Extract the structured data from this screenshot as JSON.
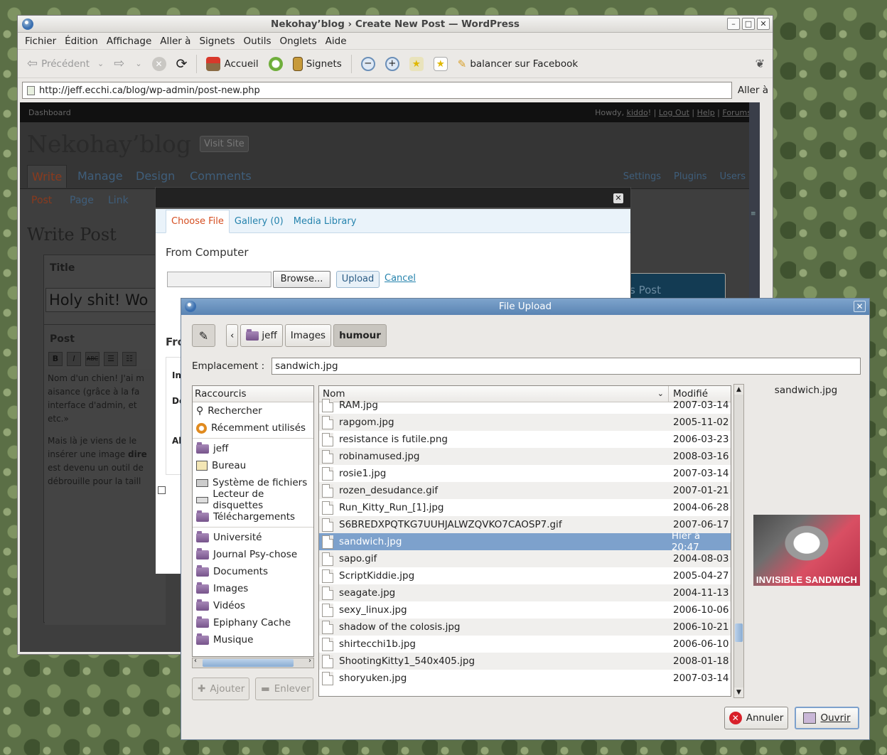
{
  "browser": {
    "title": "Nekohay’blog › Create New Post — WordPress",
    "menu": [
      "Fichier",
      "Édition",
      "Affichage",
      "Aller à",
      "Signets",
      "Outils",
      "Onglets",
      "Aide"
    ],
    "toolbar": {
      "back": "Précédent",
      "home": "Accueil",
      "bookmarks": "Signets",
      "facebook": "balancer sur Facebook"
    },
    "url": "http://jeff.ecchi.ca/blog/wp-admin/post-new.php",
    "go": "Aller à"
  },
  "wp": {
    "dashboard": "Dashboard",
    "howdy": "Howdy,",
    "user": "kiddo",
    "user_links": [
      "Log Out",
      "Help",
      "Forums"
    ],
    "blog_name": "Nekohay’blog",
    "visit_site": "Visit Site",
    "main_tabs": [
      "Write",
      "Manage",
      "Design",
      "Comments"
    ],
    "right_tabs": [
      "Settings",
      "Plugins",
      "Users"
    ],
    "sub_tabs": [
      "Post",
      "Page",
      "Link"
    ],
    "page_heading": "Write Post",
    "title_label": "Title",
    "title_value": "Holy shit! Wo",
    "post_label": "Post",
    "post_text_1": [
      "Nom d'un chien! J'ai m",
      "aisance (grâce à la fa",
      "interface d'admin, et",
      "etc.»"
    ],
    "post_text_2_lines": [
      "Mais là je viens de le",
      "insérer une image ",
      "est devenu un outil de",
      "débrouille pour la taill"
    ],
    "post_text_2_bold": "dire",
    "side_button": "s Post"
  },
  "media": {
    "tabs": [
      "Choose File",
      "Gallery (0)",
      "Media Library"
    ],
    "heading": "From Computer",
    "browse": "Browse...",
    "upload": "Upload",
    "cancel": "Cancel",
    "partial_heading": "Fro",
    "partial_labels": [
      "In",
      "De",
      "Al"
    ]
  },
  "file_upload": {
    "title": "File Upload",
    "path": [
      "jeff",
      "Images",
      "humour"
    ],
    "location_label": "Emplacement :",
    "location_value": "sandwich.jpg",
    "shortcuts_header": "Raccourcis",
    "shortcuts_top": [
      "Rechercher",
      "Récemment utilisés"
    ],
    "shortcuts_places": [
      "jeff",
      "Bureau",
      "Système de fichiers",
      "Lecteur de disquettes",
      "Téléchargements"
    ],
    "shortcuts_bookmarks": [
      "Université",
      "Journal Psy-chose",
      "Documents",
      "Images",
      "Vidéos",
      "Epiphany Cache",
      "Musique"
    ],
    "add_button": "Ajouter",
    "remove_button": "Enlever",
    "col_name": "Nom",
    "col_modified": "Modifié",
    "files": [
      {
        "name": "RAM.jpg",
        "date": "2007-03-14"
      },
      {
        "name": "rapgom.jpg",
        "date": "2005-11-02"
      },
      {
        "name": "resistance is futile.png",
        "date": "2006-03-23"
      },
      {
        "name": "robinamused.jpg",
        "date": "2008-03-16"
      },
      {
        "name": "rosie1.jpg",
        "date": "2007-03-14"
      },
      {
        "name": "rozen_desudance.gif",
        "date": "2007-01-21"
      },
      {
        "name": "Run_Kitty_Run_[1].jpg",
        "date": "2004-06-28"
      },
      {
        "name": "S6BREDXPQTKG7UUHJALWZQVKO7CAOSP7.gif",
        "date": "2007-06-17"
      },
      {
        "name": "sandwich.jpg",
        "date": "Hier à 20:47",
        "selected": true
      },
      {
        "name": "sapo.gif",
        "date": "2004-08-03"
      },
      {
        "name": "ScriptKiddie.jpg",
        "date": "2005-04-27"
      },
      {
        "name": "seagate.jpg",
        "date": "2004-11-13"
      },
      {
        "name": "sexy_linux.jpg",
        "date": "2006-10-06"
      },
      {
        "name": "shadow of the colosis.jpg",
        "date": "2006-10-21"
      },
      {
        "name": "shirtecchi1b.jpg",
        "date": "2006-06-10"
      },
      {
        "name": "ShootingKitty1_540x405.jpg",
        "date": "2008-01-18"
      },
      {
        "name": "shoryuken.jpg",
        "date": "2007-03-14"
      }
    ],
    "preview_name": "sandwich.jpg",
    "preview_caption": "INVISIBLE SANDWICH",
    "cancel": "Annuler",
    "open": "Ouvrir"
  }
}
